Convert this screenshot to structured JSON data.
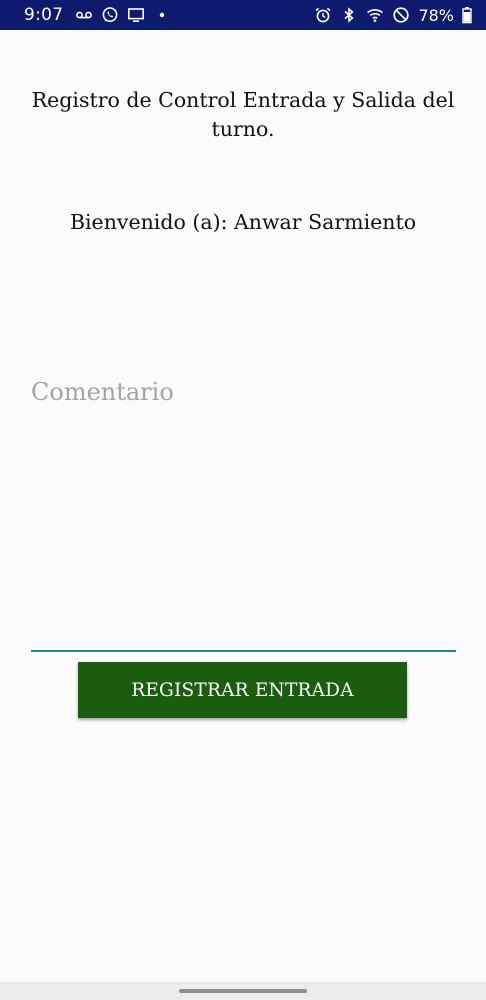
{
  "status_bar": {
    "time": "9:07",
    "battery": "78%",
    "left_icons": [
      "voicemail-icon",
      "whatsapp-icon",
      "screen-cast-icon",
      "notification-dot-icon"
    ],
    "right_icons": [
      "alarm-icon",
      "bluetooth-icon",
      "wifi-icon",
      "do-not-disturb-icon",
      "battery-icon"
    ],
    "color": "#0d1a6e"
  },
  "screen": {
    "title": "Registro de Control Entrada y Salida del turno.",
    "welcome": "Bienvenido (a): Anwar Sarmiento",
    "comment": {
      "placeholder": "Comentario",
      "value": ""
    },
    "register_button_label": "REGISTRAR ENTRADA"
  },
  "colors": {
    "accent": "#1f8a80",
    "button": "#1b5e10",
    "background": "#fbfbfd"
  }
}
